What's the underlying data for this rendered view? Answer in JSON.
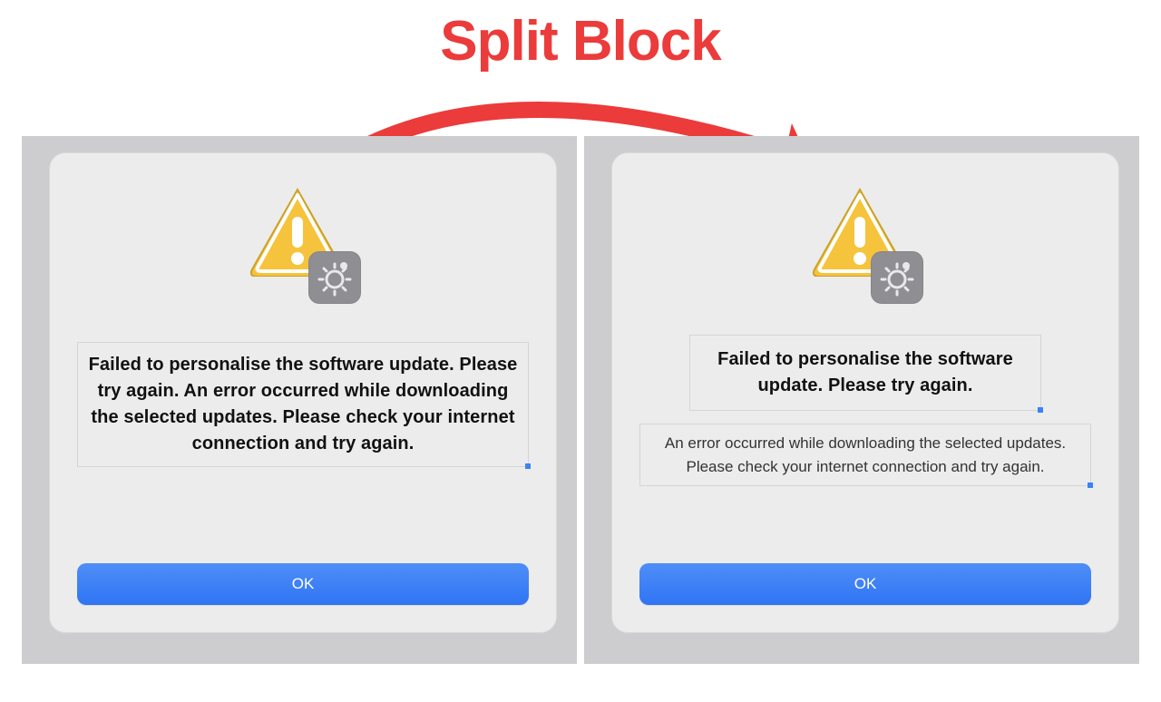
{
  "title": "Split Block",
  "colors": {
    "accent_red": "#eb3b3b",
    "button_blue": "#2f74f4"
  },
  "icons": {
    "warning": "warning-triangle-icon",
    "gear": "gear-badge-icon",
    "arrow": "curved-arrow-icon"
  },
  "left_dialog": {
    "message": "Failed to personalise the software update. Please try again. An error occurred while downloading the selected updates. Please check your internet connection and try again.",
    "ok_label": "OK"
  },
  "right_dialog": {
    "primary_message": "Failed to personalise the software update. Please try again.",
    "secondary_message": "An error occurred while downloading the selected updates. Please check your internet connection and try again.",
    "ok_label": "OK"
  }
}
